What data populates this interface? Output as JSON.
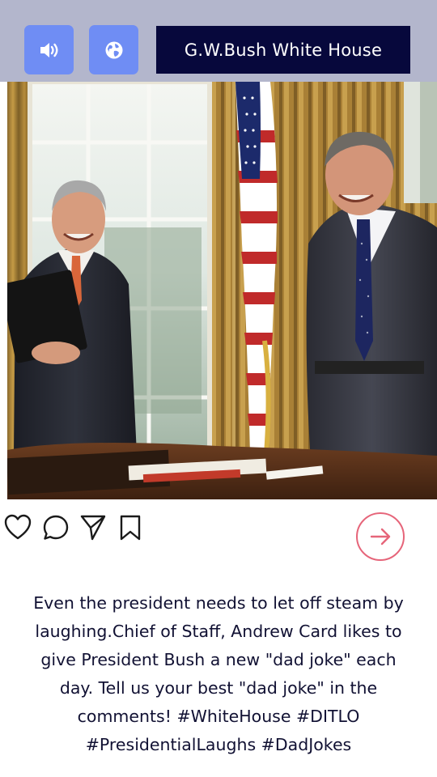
{
  "header": {
    "title": "G.W.Bush White House",
    "sound_icon": "speaker-icon",
    "globe_icon": "globe-icon",
    "accent_color": "#6f8df4",
    "title_bg": "#07083c"
  },
  "photo": {
    "subject": "photo-of-two-men-laughing-in-oval-office"
  },
  "actions": {
    "like_icon": "heart-icon",
    "comment_icon": "comment-icon",
    "share_icon": "send-icon",
    "save_icon": "bookmark-icon",
    "next_icon": "arrow-right-icon",
    "next_color": "#e6657a"
  },
  "caption": {
    "text": "Even the president needs to let off steam by laughing.Chief of Staff, Andrew Card likes to give President Bush a new \"dad joke\" each day. Tell us your best \"dad joke\" in the comments! #WhiteHouse #DITLO #PresidentialLaughs #DadJokes"
  }
}
